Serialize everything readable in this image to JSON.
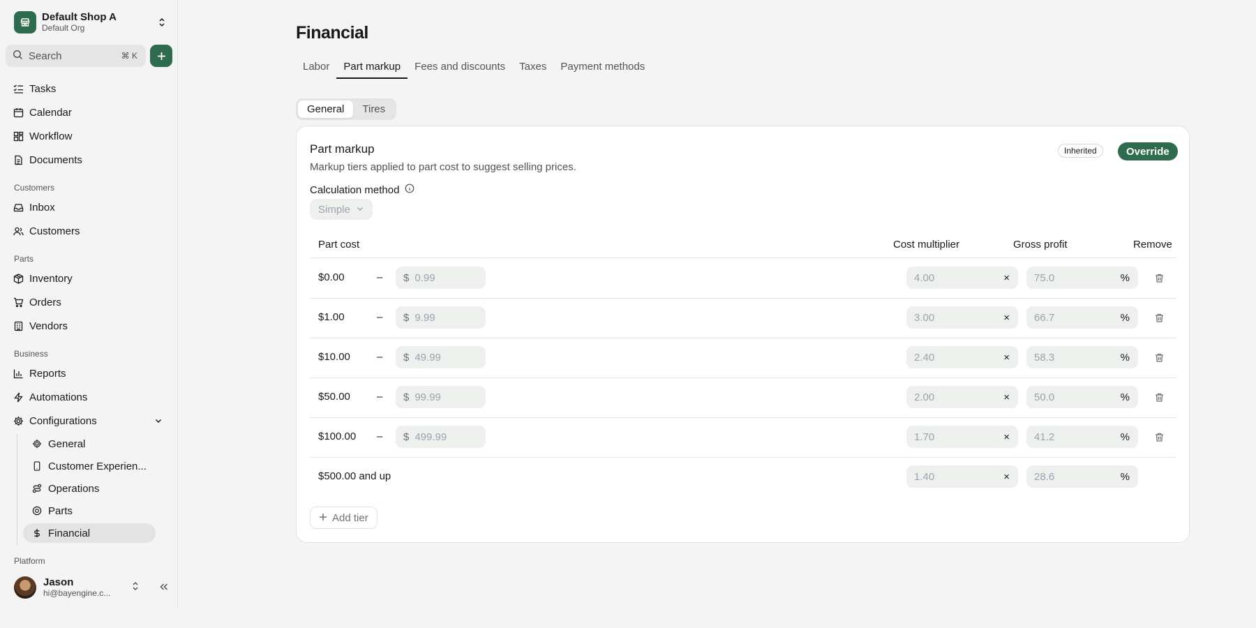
{
  "sidebar": {
    "shop": {
      "name": "Default Shop A",
      "org": "Default Org"
    },
    "search": {
      "label": "Search",
      "shortcut": "⌘ K"
    },
    "nav": [
      {
        "label": "Tasks",
        "icon": "list-checks-icon"
      },
      {
        "label": "Calendar",
        "icon": "calendar-icon"
      },
      {
        "label": "Workflow",
        "icon": "workflow-icon"
      },
      {
        "label": "Documents",
        "icon": "document-icon"
      }
    ],
    "sections": {
      "customers": "Customers",
      "parts": "Parts",
      "business": "Business",
      "platform": "Platform"
    },
    "customers_nav": [
      {
        "label": "Inbox",
        "icon": "inbox-icon"
      },
      {
        "label": "Customers",
        "icon": "users-icon"
      }
    ],
    "parts_nav": [
      {
        "label": "Inventory",
        "icon": "package-icon"
      },
      {
        "label": "Orders",
        "icon": "cart-icon"
      },
      {
        "label": "Vendors",
        "icon": "building-icon"
      }
    ],
    "business_nav": [
      {
        "label": "Reports",
        "icon": "bar-chart-icon"
      },
      {
        "label": "Automations",
        "icon": "zap-icon"
      },
      {
        "label": "Configurations",
        "icon": "gear-icon"
      }
    ],
    "config_sub": [
      {
        "label": "General",
        "icon": "gear-icon"
      },
      {
        "label": "Customer Experien...",
        "icon": "smartphone-icon"
      },
      {
        "label": "Operations",
        "icon": "route-icon"
      },
      {
        "label": "Parts",
        "icon": "parts-icon"
      },
      {
        "label": "Financial",
        "icon": "dollar-icon"
      }
    ],
    "user": {
      "name": "Jason",
      "email": "hi@bayengine.c..."
    }
  },
  "main": {
    "title": "Financial",
    "tabs": [
      "Labor",
      "Part markup",
      "Fees and discounts",
      "Taxes",
      "Payment methods"
    ],
    "active_tab": "Part markup",
    "segments": [
      "General",
      "Tires"
    ],
    "active_segment": "General",
    "card": {
      "title": "Part markup",
      "description": "Markup tiers applied to part cost to suggest selling prices.",
      "badge": "Inherited",
      "override_label": "Override",
      "calc_label": "Calculation method",
      "calc_value": "Simple",
      "headers": {
        "part_cost": "Part cost",
        "cost_multiplier": "Cost multiplier",
        "gross_profit": "Gross profit",
        "remove": "Remove"
      },
      "dash": "–",
      "currency": "$",
      "mult_suffix": "×",
      "pct_suffix": "%",
      "rows": [
        {
          "from": "$0.00",
          "to": "0.99",
          "multiplier": "4.00",
          "gross_profit": "75.0"
        },
        {
          "from": "$1.00",
          "to": "9.99",
          "multiplier": "3.00",
          "gross_profit": "66.7"
        },
        {
          "from": "$10.00",
          "to": "49.99",
          "multiplier": "2.40",
          "gross_profit": "58.3"
        },
        {
          "from": "$50.00",
          "to": "99.99",
          "multiplier": "2.00",
          "gross_profit": "50.0"
        },
        {
          "from": "$100.00",
          "to": "499.99",
          "multiplier": "1.70",
          "gross_profit": "41.2"
        }
      ],
      "last_row": {
        "from": "$500.00 and up",
        "multiplier": "1.40",
        "gross_profit": "28.6"
      },
      "add_tier": "Add tier"
    }
  },
  "colors": {
    "accent": "#2f6b4f",
    "background": "#f3f4f3",
    "card": "#ffffff",
    "muted": "#52525b"
  }
}
